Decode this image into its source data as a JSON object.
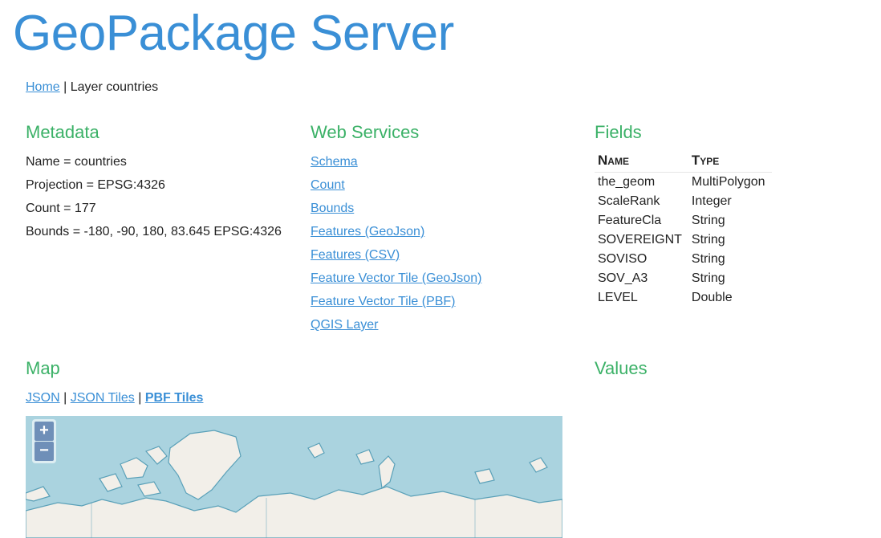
{
  "title": "GeoPackage Server",
  "breadcrumb": {
    "home": "Home",
    "separator": "|",
    "current": "Layer countries"
  },
  "metadata": {
    "heading": "Metadata",
    "items": [
      "Name = countries",
      "Projection = EPSG:4326",
      "Count = 177",
      "Bounds = -180, -90, 180, 83.645 EPSG:4326"
    ]
  },
  "web_services": {
    "heading": "Web Services",
    "links": [
      "Schema",
      "Count",
      "Bounds",
      "Features (GeoJson)",
      "Features (CSV)",
      "Feature Vector Tile (GeoJson)",
      "Feature Vector Tile (PBF)",
      "QGIS Layer"
    ]
  },
  "fields": {
    "heading": "Fields",
    "columns": [
      "Name",
      "Type"
    ],
    "rows": [
      [
        "the_geom",
        "MultiPolygon"
      ],
      [
        "ScaleRank",
        "Integer"
      ],
      [
        "FeatureCla",
        "String"
      ],
      [
        "SOVEREIGNT",
        "String"
      ],
      [
        "SOVISO",
        "String"
      ],
      [
        "SOV_A3",
        "String"
      ],
      [
        "LEVEL",
        "Double"
      ]
    ]
  },
  "map": {
    "heading": "Map",
    "links": [
      "JSON",
      "JSON Tiles",
      "PBF Tiles"
    ],
    "separator": "|",
    "zoom_in": "+",
    "zoom_out": "−",
    "colors": {
      "water": "#aad3df",
      "land": "#f2efe9",
      "coast": "#5aa0b8"
    }
  },
  "values": {
    "heading": "Values"
  },
  "colors": {
    "title": "#3a8fd6",
    "section": "#3bb167",
    "link": "#3a8fd6"
  }
}
